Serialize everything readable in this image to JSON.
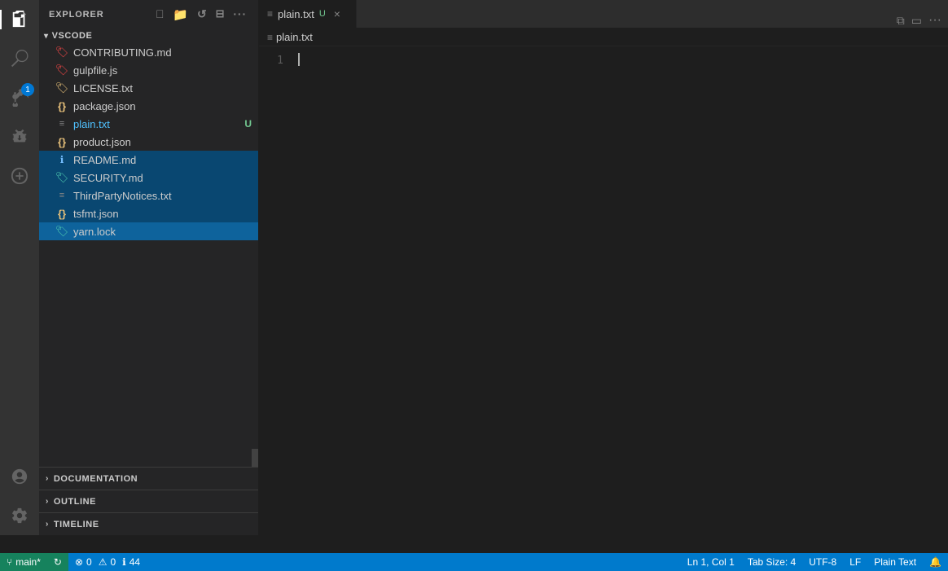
{
  "activityBar": {
    "icons": [
      {
        "name": "files-icon",
        "symbol": "⎘",
        "active": true,
        "badge": null
      },
      {
        "name": "search-icon",
        "symbol": "⌕",
        "active": false,
        "badge": null
      },
      {
        "name": "git-icon",
        "symbol": "⑂",
        "active": false,
        "badge": "1"
      },
      {
        "name": "debug-icon",
        "symbol": "▷",
        "active": false,
        "badge": null
      },
      {
        "name": "extensions-icon",
        "symbol": "⊞",
        "active": false,
        "badge": null
      }
    ],
    "bottomIcons": [
      {
        "name": "account-icon",
        "symbol": "◯"
      },
      {
        "name": "settings-icon",
        "symbol": "⚙"
      }
    ]
  },
  "sidebar": {
    "title": "EXPLORER",
    "actions": [
      "new-file",
      "new-folder",
      "refresh",
      "collapse"
    ],
    "folder": {
      "name": "VSCODE",
      "expanded": true
    },
    "files": [
      {
        "name": "CONTRIBUTING.md",
        "icon": "md-red",
        "badge": null
      },
      {
        "name": "gulpfile.js",
        "icon": "js-red",
        "badge": null
      },
      {
        "name": "LICENSE.txt",
        "icon": "txt-yellow",
        "badge": null
      },
      {
        "name": "package.json",
        "icon": "json",
        "badge": null
      },
      {
        "name": "plain.txt",
        "icon": "txt",
        "badge": "U",
        "active": true
      },
      {
        "name": "product.json",
        "icon": "json",
        "badge": null
      },
      {
        "name": "README.md",
        "icon": "md-info",
        "badge": null,
        "selected": true
      },
      {
        "name": "SECURITY.md",
        "icon": "md-teal",
        "badge": null,
        "selected": true
      },
      {
        "name": "ThirdPartyNotices.txt",
        "icon": "txt",
        "badge": null,
        "selected": true
      },
      {
        "name": "tsfmt.json",
        "icon": "json",
        "badge": null,
        "selected": true
      },
      {
        "name": "yarn.lock",
        "icon": "lock-teal",
        "badge": null,
        "selected": true
      }
    ],
    "sections": [
      {
        "name": "DOCUMENTATION",
        "expanded": false
      },
      {
        "name": "OUTLINE",
        "expanded": false
      },
      {
        "name": "TIMELINE",
        "expanded": false
      }
    ]
  },
  "editor": {
    "tab": {
      "icon": "≡",
      "name": "plain.txt",
      "unsaved": "U",
      "close": "×"
    },
    "breadcrumb": "plain.txt",
    "breadcrumb_icon": "≡",
    "lineNumber": "1",
    "content": ""
  },
  "statusBar": {
    "gitBranch": "main*",
    "syncIcon": "↻",
    "errors": "0",
    "warnings": "0",
    "info": "44",
    "position": "Ln 1, Col 1",
    "tabSize": "Tab Size: 4",
    "encoding": "UTF-8",
    "lineEnding": "LF",
    "language": "Plain Text",
    "bell": "🔔"
  }
}
